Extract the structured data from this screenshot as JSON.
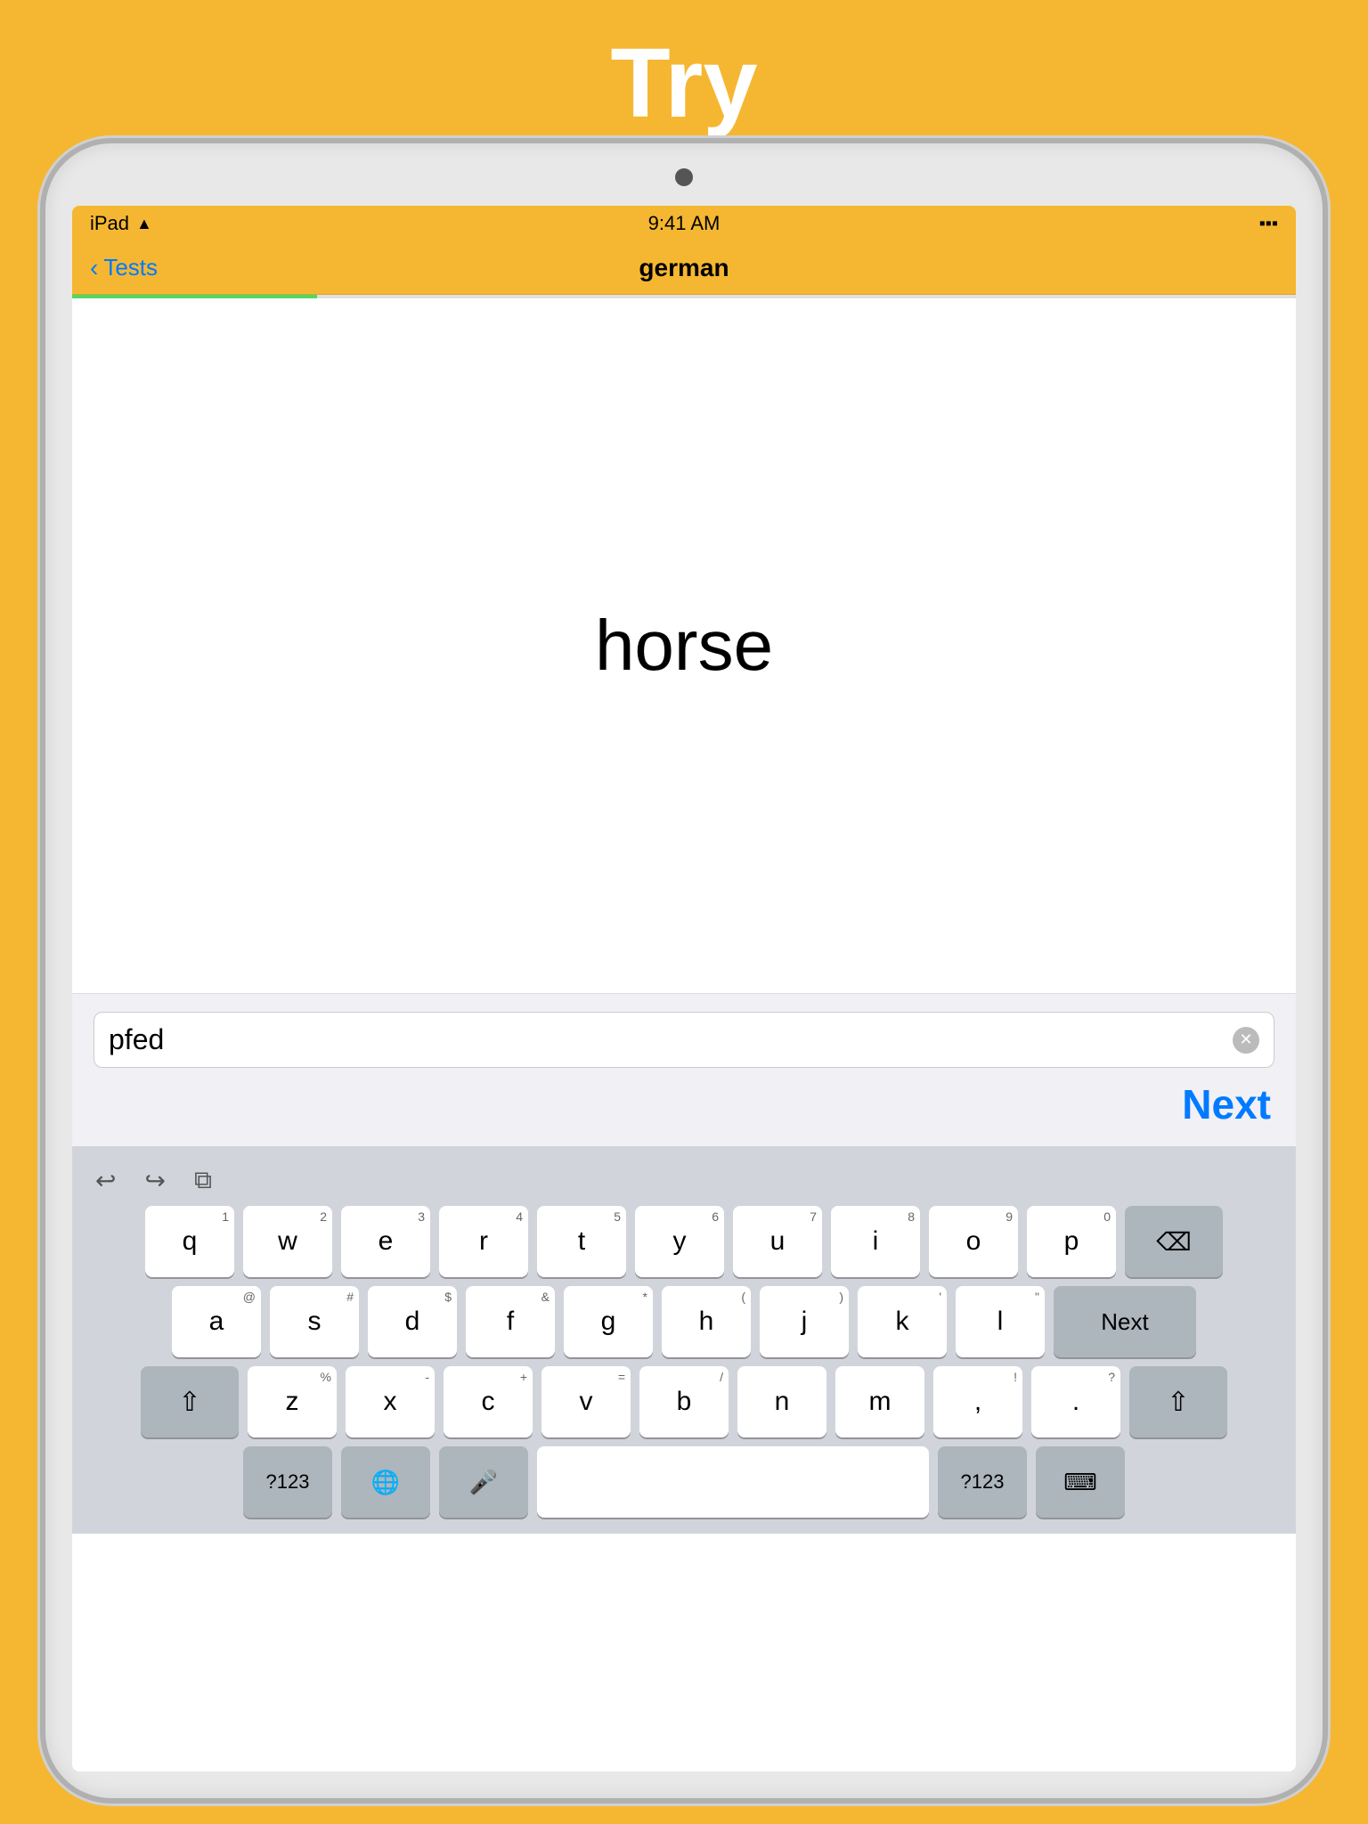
{
  "page": {
    "title": "Try",
    "background_color": "#F5B731"
  },
  "status_bar": {
    "device": "iPad",
    "time": "9:41 AM",
    "wifi": true,
    "battery": "full"
  },
  "nav_bar": {
    "back_label": "Tests",
    "title": "german"
  },
  "content": {
    "word": "horse"
  },
  "input": {
    "value": "pfed",
    "placeholder": "",
    "clear_label": "×",
    "next_label": "Next"
  },
  "keyboard": {
    "toolbar": {
      "undo_label": "↩",
      "redo_label": "↪",
      "clipboard_label": "⧉"
    },
    "rows": [
      {
        "keys": [
          {
            "char": "q",
            "num": "1"
          },
          {
            "char": "w",
            "num": "2"
          },
          {
            "char": "e",
            "num": "3"
          },
          {
            "char": "r",
            "num": "4"
          },
          {
            "char": "t",
            "num": "5"
          },
          {
            "char": "y",
            "num": "6"
          },
          {
            "char": "u",
            "num": "7"
          },
          {
            "char": "i",
            "num": "8"
          },
          {
            "char": "o",
            "num": "9"
          },
          {
            "char": "p",
            "num": "0"
          }
        ],
        "special_right": "backspace"
      },
      {
        "keys": [
          {
            "char": "a",
            "num": "@"
          },
          {
            "char": "s",
            "num": "#"
          },
          {
            "char": "d",
            "num": "$"
          },
          {
            "char": "f",
            "num": "&"
          },
          {
            "char": "g",
            "num": "*"
          },
          {
            "char": "h",
            "num": "("
          },
          {
            "char": "j",
            "num": ")"
          },
          {
            "char": "k",
            "num": "'"
          },
          {
            "char": "l",
            "num": "\""
          }
        ],
        "special_right": "next"
      },
      {
        "keys": [
          {
            "char": "z",
            "num": "%"
          },
          {
            "char": "x",
            "num": "-"
          },
          {
            "char": "c",
            "num": "+"
          },
          {
            "char": "v",
            "num": "="
          },
          {
            "char": "b",
            "num": "/"
          },
          {
            "char": "n",
            "num": ""
          },
          {
            "char": "m",
            "num": ""
          },
          {
            "char": ",",
            "num": "!"
          },
          {
            "char": ".",
            "num": "?"
          }
        ],
        "special_left": "shift",
        "special_right": "shift"
      },
      {
        "bottom_row": true,
        "num_label": "?123",
        "space_label": "",
        "emoji_label": "☺",
        "num2_label": "?123",
        "hide_label": "⌨"
      }
    ],
    "next_key_label": "Next"
  }
}
